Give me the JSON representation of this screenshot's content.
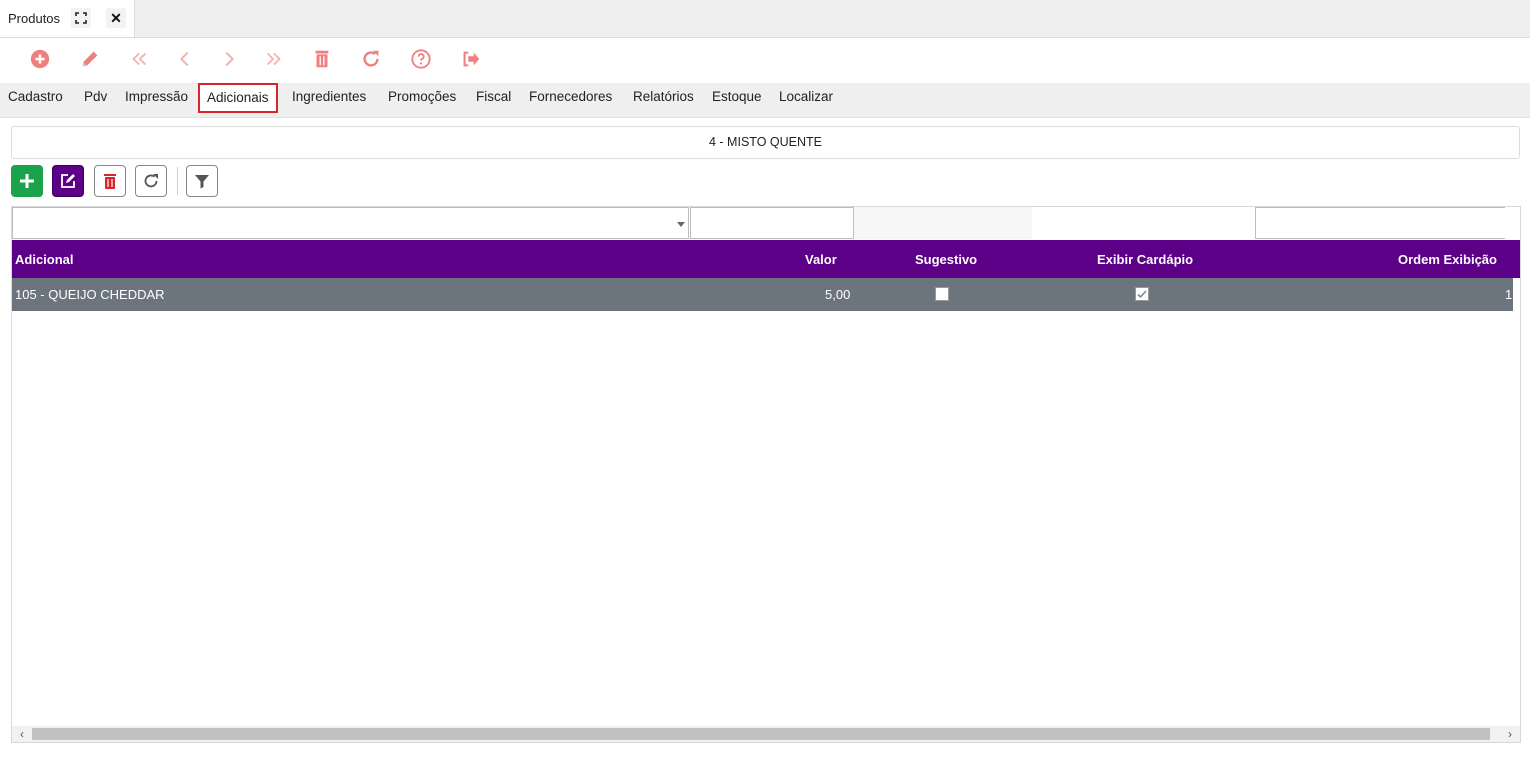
{
  "window": {
    "tab_title": "Produtos"
  },
  "toolbar": {
    "icons": [
      "add-circle-icon",
      "edit-pencil-icon",
      "first-record-icon",
      "previous-record-icon",
      "next-record-icon",
      "last-record-icon",
      "trash-icon",
      "refresh-icon",
      "help-icon",
      "exit-icon"
    ],
    "color": "#f07f7f"
  },
  "nav": {
    "items": [
      "Cadastro",
      "Pdv",
      "Impressão",
      "Adicionais",
      "Ingredientes",
      "Promoções",
      "Fiscal",
      "Fornecedores",
      "Relatórios",
      "Estoque",
      "Localizar"
    ],
    "active": "Adicionais"
  },
  "product": {
    "label": "4 - MISTO QUENTE"
  },
  "actions": {
    "icons": [
      "plus-icon",
      "edit-icon",
      "trash-icon",
      "refresh-icon",
      "filter-icon"
    ],
    "colors": {
      "add": "#1aa34a",
      "edit": "#5b0087",
      "delete": "#d9232d"
    }
  },
  "grid": {
    "columns": [
      "Adicional",
      "Valor",
      "Sugestivo",
      "Exibir Cardápio",
      "Ordem Exibição"
    ],
    "header_color": "#5b0087",
    "rows": [
      {
        "adicional": "105 - QUEIJO CHEDDAR",
        "valor": "5,00",
        "sugestivo": false,
        "exibir_cardapio": true,
        "ordem_exibicao": "1"
      }
    ]
  }
}
